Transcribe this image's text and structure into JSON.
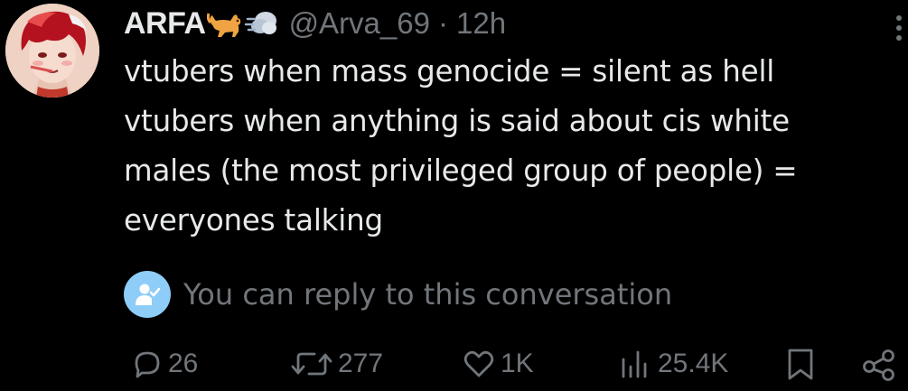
{
  "tweet": {
    "author": {
      "display_name": "ARFA",
      "handle": "@Arva_69",
      "separator": "·",
      "time": "12h",
      "name_emojis": [
        "dog-emoji",
        "dash-emoji"
      ]
    },
    "text_lines": [
      "vtubers when mass genocide = silent as hell",
      "vtubers when anything is said about cis white",
      "males (the most privileged group of people) =",
      "everyones talking"
    ],
    "reply_notice": "You can reply to this conversation",
    "actions": {
      "replies": "26",
      "reposts": "277",
      "likes": "1K",
      "views": "25.4K"
    }
  },
  "colors": {
    "background": "#000000",
    "text_primary": "#e7e9ea",
    "text_secondary": "#71767b",
    "reply_badge": "#8ecdf8"
  },
  "icons": [
    "more-icon",
    "reply-icon",
    "repost-icon",
    "like-icon",
    "views-icon",
    "bookmark-icon",
    "share-icon",
    "user-check-icon"
  ]
}
